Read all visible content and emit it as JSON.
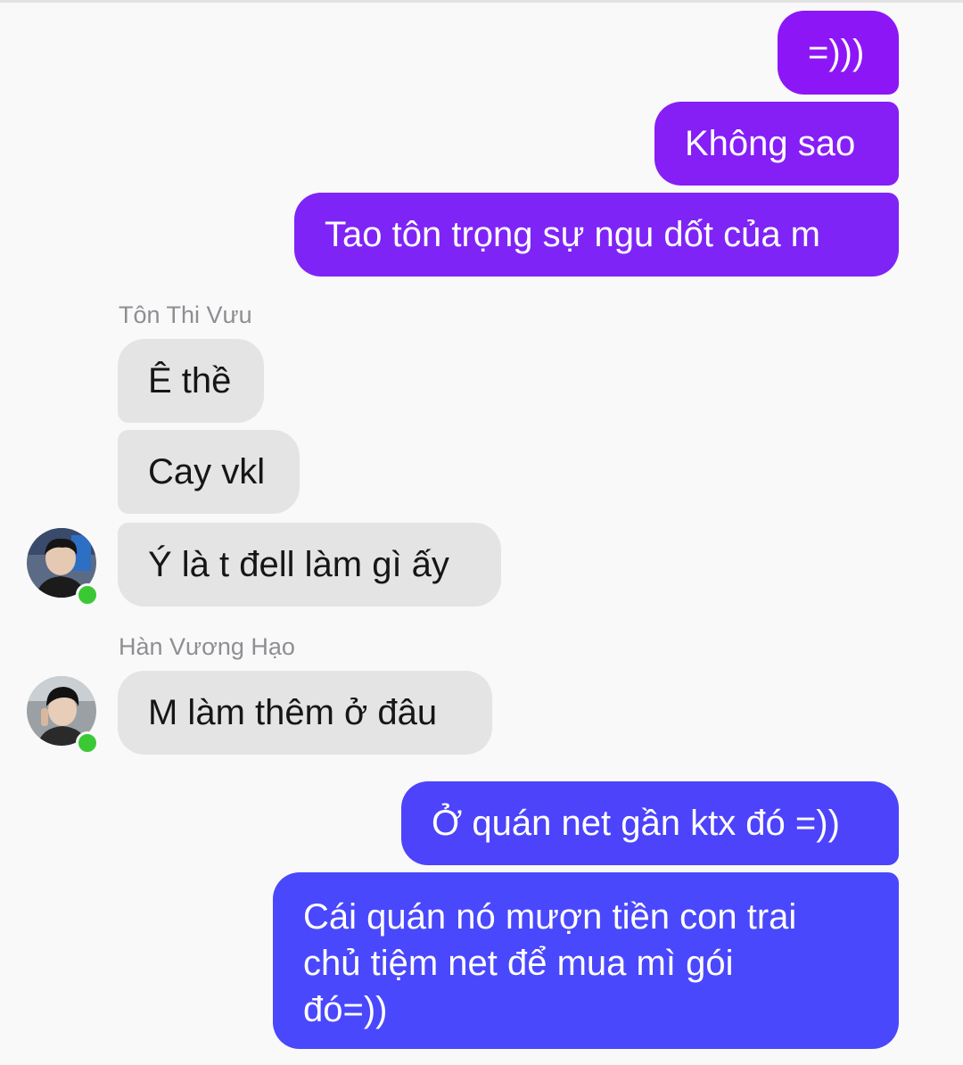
{
  "messages": [
    {
      "id": "m1",
      "direction": "sent",
      "text": "=)))"
    },
    {
      "id": "m2",
      "direction": "sent",
      "text": "Không sao"
    },
    {
      "id": "m3",
      "direction": "sent",
      "text": "Tao tôn trọng sự ngu dốt của m"
    },
    {
      "id": "m4",
      "direction": "received",
      "sender": "Tôn Thi Vưu",
      "text": "Ê thề"
    },
    {
      "id": "m5",
      "direction": "received",
      "sender": "Tôn Thi Vưu",
      "text": "Cay vkl"
    },
    {
      "id": "m6",
      "direction": "received",
      "sender": "Tôn Thi Vưu",
      "text": "Ý là t đell làm gì ấy"
    },
    {
      "id": "m7",
      "direction": "received",
      "sender": "Hàn Vương Hạo",
      "text": "M làm thêm ở đâu"
    },
    {
      "id": "m8",
      "direction": "sent",
      "text": "Ở quán net gần ktx đó =))"
    },
    {
      "id": "m9",
      "direction": "sent",
      "lines": [
        "Cái quán nó mượn tiền con trai",
        "chủ tiệm net để mua mì gói",
        "đó=))"
      ]
    }
  ],
  "senders": {
    "ton_thi_vuu": {
      "name": "Tôn Thi Vưu",
      "online": true
    },
    "han_vuong_hao": {
      "name": "Hàn Vương Hạo",
      "online": true
    }
  },
  "colors": {
    "sent_bubble_top": "#8a1cf5",
    "sent_bubble_mid": "#7a2cf5",
    "sent_bubble_bottom": "#4b45fb",
    "received_bubble": "#e4e4e4",
    "online_indicator": "#3ac935",
    "sender_name": "#8e8e93"
  }
}
